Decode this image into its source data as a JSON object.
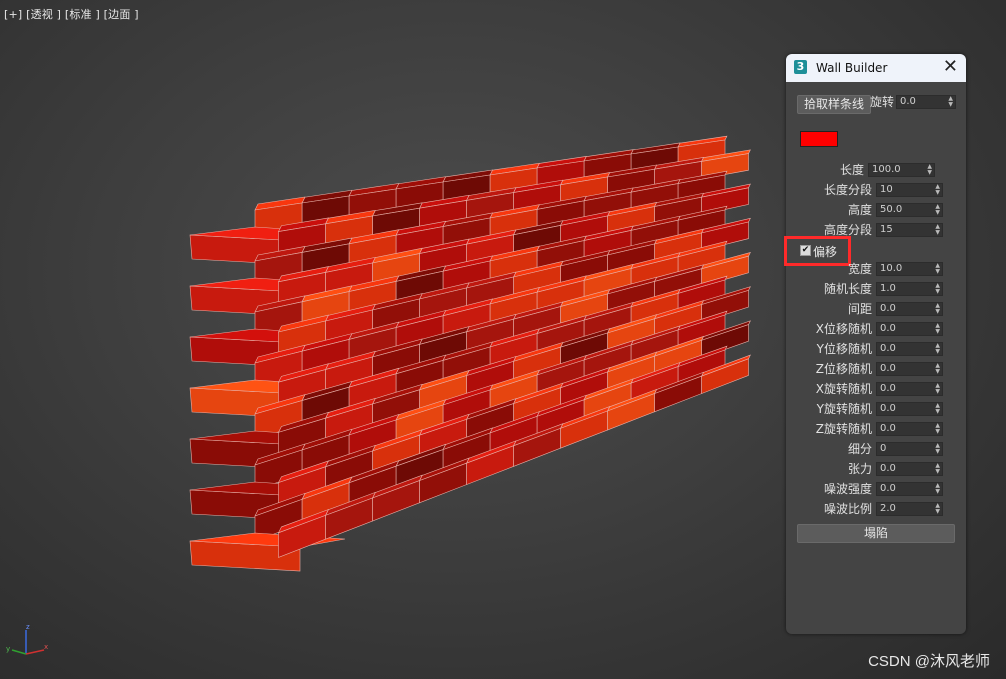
{
  "viewport": {
    "label": "[+] [透视 ] [标准 ] [边面 ]"
  },
  "scene": {
    "brick_colors": [
      "#8a0c06",
      "#b00d0a",
      "#c81a0e",
      "#d8300c",
      "#6e0a05",
      "#a5150d",
      "#e64510",
      "#920f08"
    ]
  },
  "axis": {
    "x": "x",
    "y": "y",
    "z": "z"
  },
  "panel": {
    "title": "Wall Builder",
    "close_icon": "✕",
    "pick_spline_label": "拾取样条线",
    "rotate_label": "旋转",
    "rotate_value": "0.0",
    "color": "#ff0000",
    "offset_label": "偏移",
    "offset_checked": true,
    "fields": [
      {
        "label": "长度",
        "value": "100.0"
      },
      {
        "label": "长度分段",
        "value": "10"
      },
      {
        "label": "高度",
        "value": "50.0"
      },
      {
        "label": "高度分段",
        "value": "15"
      },
      {
        "label": "宽度",
        "value": "10.0"
      },
      {
        "label": "随机长度",
        "value": "1.0"
      },
      {
        "label": "间距",
        "value": "0.0"
      },
      {
        "label": "X位移随机",
        "value": "0.0"
      },
      {
        "label": "Y位移随机",
        "value": "0.0"
      },
      {
        "label": "Z位移随机",
        "value": "0.0"
      },
      {
        "label": "X旋转随机",
        "value": "0.0"
      },
      {
        "label": "Y旋转随机",
        "value": "0.0"
      },
      {
        "label": "Z旋转随机",
        "value": "0.0"
      },
      {
        "label": "细分",
        "value": "0"
      },
      {
        "label": "张力",
        "value": "0.0"
      },
      {
        "label": "噪波强度",
        "value": "0.0"
      },
      {
        "label": "噪波比例",
        "value": "2.0"
      }
    ],
    "collapse_label": "塌陷"
  },
  "watermark": "CSDN @沐风老师"
}
